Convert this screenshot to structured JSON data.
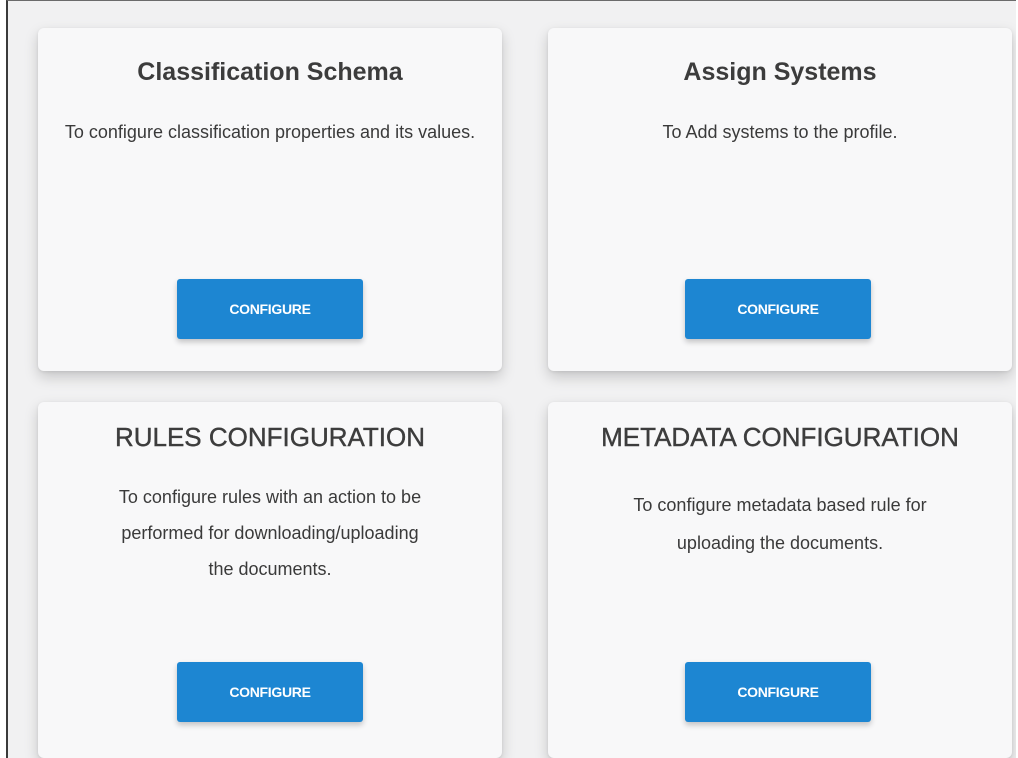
{
  "cards": [
    {
      "title": "Classification Schema",
      "description": "To configure classification properties and its values.",
      "button_label": "CONFIGURE"
    },
    {
      "title": "Assign Systems",
      "description": "To Add systems to the profile.",
      "button_label": "CONFIGURE"
    },
    {
      "title": "RULES CONFIGURATION",
      "description": "To configure rules with an action to be performed for downloading/uploading the documents.",
      "button_label": "CONFIGURE"
    },
    {
      "title": "METADATA CONFIGURATION",
      "description": "To configure metadata based rule for uploading the documents.",
      "button_label": "CONFIGURE"
    }
  ],
  "colors": {
    "accent": "#1d86d2",
    "card_background": "#f8f8f9",
    "page_background": "#f1f1f2"
  }
}
